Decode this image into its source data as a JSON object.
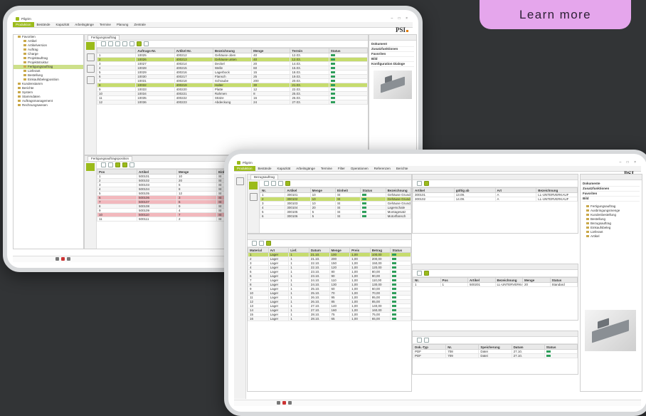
{
  "cta": {
    "label": "Learn more"
  },
  "colors": {
    "background": "#323436",
    "cta": "#e5a6ec",
    "accent": "#9bbb1b"
  },
  "screen_a": {
    "app_title": "Pilgrim",
    "brand": "PSI",
    "menu": [
      "Produktion",
      "Bestände",
      "Kapazität",
      "Arbeitsgänge",
      "Termine",
      "Planung",
      "Zentrale"
    ],
    "tab": "Fertigungsauftrag",
    "tree": [
      {
        "label": "Favoriten",
        "depth": 1
      },
      {
        "label": "Artikel",
        "depth": 2
      },
      {
        "label": "Artikelversion",
        "depth": 2
      },
      {
        "label": "Auftrag",
        "depth": 2
      },
      {
        "label": "Charge",
        "depth": 2
      },
      {
        "label": "Projektauftrag",
        "depth": 2
      },
      {
        "label": "Projektstruktur",
        "depth": 2
      },
      {
        "label": "Fertigungsauftrag",
        "depth": 2,
        "highlight": true
      },
      {
        "label": "Lieferant",
        "depth": 2
      },
      {
        "label": "Bestellung",
        "depth": 2
      },
      {
        "label": "Einkaufsbelegposition",
        "depth": 2
      },
      {
        "label": "Kundenstamm",
        "depth": 1
      },
      {
        "label": "Berichte",
        "depth": 1
      },
      {
        "label": "System",
        "depth": 1
      },
      {
        "label": "Stammdaten",
        "depth": 1
      },
      {
        "label": "Auftragsmanagement",
        "depth": 1
      },
      {
        "label": "Rechnungswesen",
        "depth": 1
      }
    ],
    "grid1": {
      "columns": [
        "",
        "Auftrags-Nr.",
        "Artikel-Nr.",
        "Bezeichnung",
        "Menge",
        "Termin",
        "Status"
      ],
      "rows": [
        [
          "1",
          "10025",
          "400212",
          "Gehäuse oben",
          "40",
          "12.03.",
          "ok"
        ],
        [
          "2",
          "10026",
          "400213",
          "Gehäuse unten",
          "40",
          "12.03.",
          "ok"
        ],
        [
          "3",
          "10027",
          "400214",
          "Deckel",
          "20",
          "14.03.",
          "ok"
        ],
        [
          "4",
          "10028",
          "400215",
          "Welle",
          "60",
          "15.03.",
          "ok"
        ],
        [
          "5",
          "10029",
          "400216",
          "Lagerbock",
          "15",
          "18.03.",
          "ok"
        ],
        [
          "6",
          "10030",
          "400217",
          "Flansch",
          "25",
          "19.03.",
          "ok"
        ],
        [
          "7",
          "10031",
          "400218",
          "Schraube",
          "200",
          "20.03.",
          "ok"
        ],
        [
          "8",
          "10032",
          "400219",
          "Halter",
          "30",
          "21.03.",
          "ok"
        ],
        [
          "9",
          "10033",
          "400220",
          "Platte",
          "12",
          "22.03.",
          "ok"
        ],
        [
          "10",
          "10034",
          "400221",
          "Rahmen",
          "8",
          "25.03.",
          "ok"
        ],
        [
          "11",
          "10035",
          "400222",
          "Stütze",
          "16",
          "26.03.",
          "ok"
        ],
        [
          "12",
          "10036",
          "400223",
          "Abdeckung",
          "24",
          "27.03.",
          "ok"
        ]
      ]
    },
    "grid2_tab": "Fertigungsauftragsposition",
    "grid2": {
      "columns": [
        "Pos",
        "Artikel",
        "Menge",
        "Einheit",
        "Termin",
        "Lager",
        "Status",
        "Bemerkung"
      ],
      "rows": [
        [
          "1",
          "500101",
          "10",
          "St",
          "12.03.",
          "L1",
          "ok",
          ""
        ],
        [
          "2",
          "500102",
          "20",
          "St",
          "12.03.",
          "L1",
          "ok",
          ""
        ],
        [
          "3",
          "500103",
          "5",
          "St",
          "13.03.",
          "L2",
          "ok",
          ""
        ],
        [
          "4",
          "500104",
          "8",
          "St",
          "13.03.",
          "L2",
          "ok",
          ""
        ],
        [
          "5",
          "500105",
          "12",
          "St",
          "14.03.",
          "L1",
          "ok",
          ""
        ],
        [
          "6",
          "500106",
          "3",
          "St",
          "15.03.",
          "L3",
          "!",
          ""
        ],
        [
          "7",
          "500107",
          "6",
          "St",
          "15.03.",
          "L3",
          "!",
          ""
        ],
        [
          "8",
          "500108",
          "9",
          "St",
          "16.03.",
          "L1",
          "ok",
          ""
        ],
        [
          "9",
          "500109",
          "4",
          "St",
          "17.03.",
          "L2",
          "ok",
          ""
        ],
        [
          "10",
          "500110",
          "7",
          "St",
          "18.03.",
          "L1",
          "!",
          ""
        ],
        [
          "11",
          "500111",
          "2",
          "St",
          "19.03.",
          "L2",
          "ok",
          ""
        ]
      ]
    },
    "props": [
      "Dokument",
      "Zusatzfunktionen",
      "Favoriten",
      "Bild",
      "Konfiguration Dialoge"
    ]
  },
  "screen_b": {
    "app_title": "Pilgrim",
    "brand": "PSI",
    "menu": [
      "Produktion",
      "Bestände",
      "Kapazität",
      "Arbeitsgänge",
      "Termine",
      "Filter",
      "Operationen",
      "Referenzen",
      "Berichte"
    ],
    "tab": "Bezugsauftrag",
    "top_grid": {
      "columns": [
        "Nr.",
        "Artikel",
        "Menge",
        "Einheit",
        "Status",
        "Bezeichnung"
      ],
      "rows": [
        [
          "1",
          "300101",
          "10",
          "St",
          "ok",
          "Gehäuse Grundplatte"
        ],
        [
          "2",
          "300102",
          "10",
          "St",
          "ok",
          "Gehäuse Grundplatte"
        ],
        [
          "3",
          "300103",
          "10",
          "St",
          "ok",
          "Gehäuse Grundplatte"
        ],
        [
          "4",
          "300104",
          "20",
          "St",
          "ok",
          "Lagerschale"
        ],
        [
          "5",
          "300105",
          "5",
          "St",
          "ok",
          "Montagesatz"
        ],
        [
          "6",
          "300106",
          "5",
          "St",
          "ok",
          "Motorflansch"
        ]
      ]
    },
    "main_grid": {
      "columns": [
        "Material",
        "Art",
        "Lief.",
        "Datum",
        "Menge",
        "Preis",
        "Betrag",
        "Status"
      ],
      "rows": [
        [
          "1",
          "Lager",
          "1",
          "21.10.",
          "100",
          "1,00",
          "100,00",
          "ok"
        ],
        [
          "2",
          "Lager",
          "1",
          "21.10.",
          "200",
          "1,00",
          "200,00",
          "ok"
        ],
        [
          "3",
          "Lager",
          "1",
          "22.10.",
          "150",
          "1,00",
          "150,00",
          "ok"
        ],
        [
          "4",
          "Lager",
          "1",
          "22.10.",
          "120",
          "1,00",
          "120,00",
          "ok"
        ],
        [
          "5",
          "Lager",
          "1",
          "23.10.",
          "80",
          "1,00",
          "80,00",
          "ok"
        ],
        [
          "6",
          "Lager",
          "1",
          "23.10.",
          "90",
          "1,00",
          "90,00",
          "ok"
        ],
        [
          "7",
          "Lager",
          "1",
          "24.10.",
          "110",
          "1,00",
          "110,00",
          "ok"
        ],
        [
          "8",
          "Lager",
          "1",
          "24.10.",
          "130",
          "1,00",
          "130,00",
          "ok"
        ],
        [
          "9",
          "Lager",
          "1",
          "25.10.",
          "60",
          "1,00",
          "60,00",
          "ok"
        ],
        [
          "10",
          "Lager",
          "1",
          "25.10.",
          "70",
          "1,00",
          "70,00",
          "ok"
        ],
        [
          "11",
          "Lager",
          "1",
          "26.10.",
          "95",
          "1,00",
          "95,00",
          "ok"
        ],
        [
          "12",
          "Lager",
          "1",
          "26.10.",
          "85",
          "1,00",
          "85,00",
          "ok"
        ],
        [
          "13",
          "Lager",
          "1",
          "27.10.",
          "140",
          "1,00",
          "140,00",
          "ok"
        ],
        [
          "14",
          "Lager",
          "1",
          "27.10.",
          "160",
          "1,00",
          "160,00",
          "ok"
        ],
        [
          "15",
          "Lager",
          "1",
          "28.10.",
          "75",
          "1,00",
          "75,00",
          "ok"
        ],
        [
          "16",
          "Lager",
          "1",
          "28.10.",
          "65",
          "1,00",
          "65,00",
          "ok"
        ]
      ]
    },
    "right_top_grid": {
      "columns": [
        "Artikel",
        "gültig ab",
        "Art",
        "Bezeichnung"
      ],
      "rows": [
        [
          "300101",
          "13.09.",
          "A",
          "LL-UNTERVERKAUF"
        ],
        [
          "300102",
          "14.09.",
          "A",
          "LL-UNTERVERKAUF"
        ]
      ]
    },
    "right_mid_grid": {
      "columns": [
        "Nr.",
        "Pos",
        "Artikel",
        "Bezeichnung",
        "Menge",
        "Status"
      ],
      "rows": [
        [
          "1",
          "1",
          "500201",
          "LL-UNTERVERKAUF",
          "20",
          "Standard"
        ]
      ]
    },
    "right_bot_grid": {
      "columns": [
        "Dok.-Typ",
        "Nr.",
        "Speicherung",
        "Datum",
        "Status"
      ],
      "rows": [
        [
          "PDF",
          "708",
          "Datei",
          "27.10.",
          "ok"
        ],
        [
          "PDF",
          "709",
          "Datei",
          "27.10.",
          "ok"
        ]
      ]
    },
    "props": [
      "Dokumente",
      "Zusatzfunktionen",
      "Favoriten",
      "Bild"
    ],
    "fav_items": [
      "Fertigungsauftrag",
      "Ausbringungsmenge",
      "Kundenbestellung",
      "Bestellung",
      "Bezugsauftrag",
      "Einkaufsbeleg",
      "Lieferant",
      "Artikel"
    ]
  }
}
